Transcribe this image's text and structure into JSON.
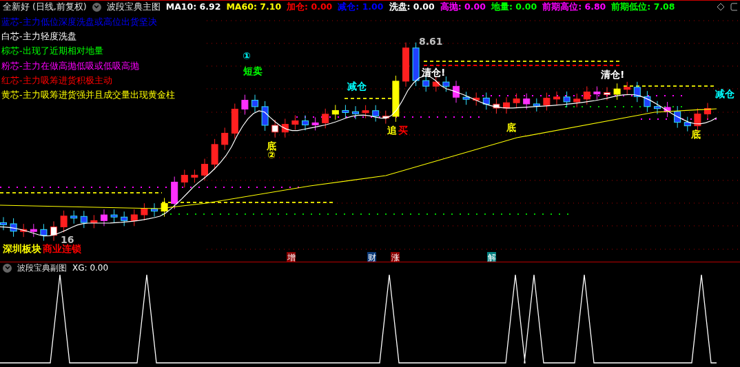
{
  "header": {
    "title": "全新好 (日线,前复权)",
    "indicator": "波段宝典主图",
    "values": [
      {
        "label": "MA10:",
        "value": "6.92",
        "color": "#ffffff"
      },
      {
        "label": "MA60:",
        "value": "7.10",
        "color": "#ffff00"
      },
      {
        "label": "加仓:",
        "value": "0.00",
        "color": "#ff0000"
      },
      {
        "label": "减仓:",
        "value": "1.00",
        "color": "#0000ff"
      },
      {
        "label": "洗盘:",
        "value": "0.00",
        "color": "#ffffff"
      },
      {
        "label": "高抛:",
        "value": "0.00",
        "color": "#ff00ff"
      },
      {
        "label": "地量:",
        "value": "0.00",
        "color": "#00ff00"
      },
      {
        "label": "前期高位:",
        "value": "6.80",
        "color": "#ff00ff"
      },
      {
        "label": "前期低位:",
        "value": "7.08",
        "color": "#00ff00"
      }
    ]
  },
  "legend": [
    {
      "text": "蓝芯-主力低位深度洗盘或高位出货坚决",
      "color": "#0000ff"
    },
    {
      "text": "白芯-主力轻度洗盘",
      "color": "#ffffff"
    },
    {
      "text": "棕芯-出现了近期相对地量",
      "color": "#00ff00"
    },
    {
      "text": "粉芯-主力在做高抛低吸或低吸高抛",
      "color": "#ff00ff"
    },
    {
      "text": "红芯-主力吸筹进货积极主动",
      "color": "#ff0000"
    },
    {
      "text": "黄芯-主力吸筹进货强并且成交量出现黄金柱",
      "color": "#ffff00"
    }
  ],
  "annotations": [
    {
      "text": "①",
      "color": "#00ffff"
    },
    {
      "text": "短卖",
      "color": "#00ff00"
    },
    {
      "text": "底",
      "color": "#ffff00"
    },
    {
      "text": "②",
      "color": "#ffff00"
    },
    {
      "text": "减仓",
      "color": "#00ffff"
    },
    {
      "text": "追",
      "color": "#ffff00"
    },
    {
      "text": "买",
      "color": "#ff0000"
    },
    {
      "text": "8.61",
      "color": "#c0c0c0"
    },
    {
      "text": "清仓!",
      "color": "#ffffff"
    },
    {
      "text": "底",
      "color": "#ffff00"
    },
    {
      "text": "清仓!",
      "color": "#ffffff"
    },
    {
      "text": "底",
      "color": "#ffff00"
    },
    {
      "text": "减仓",
      "color": "#00ffff"
    },
    {
      "text": "16",
      "color": "#c0c0c0"
    },
    {
      "text": "深圳板块",
      "color": "#ffff00"
    },
    {
      "text": "商业连锁",
      "color": "#ff0000"
    }
  ],
  "markers": [
    {
      "text": "增",
      "color": "#8b0000"
    },
    {
      "text": "财",
      "color": "#0a3a78"
    },
    {
      "text": "涨",
      "color": "#8b0000"
    },
    {
      "text": "解",
      "color": "#008080"
    }
  ],
  "sub_chart": {
    "indicator": "波段宝典副图",
    "values": [
      {
        "label": "XG:",
        "value": "0.00",
        "color": "#ffffff"
      }
    ]
  }
}
